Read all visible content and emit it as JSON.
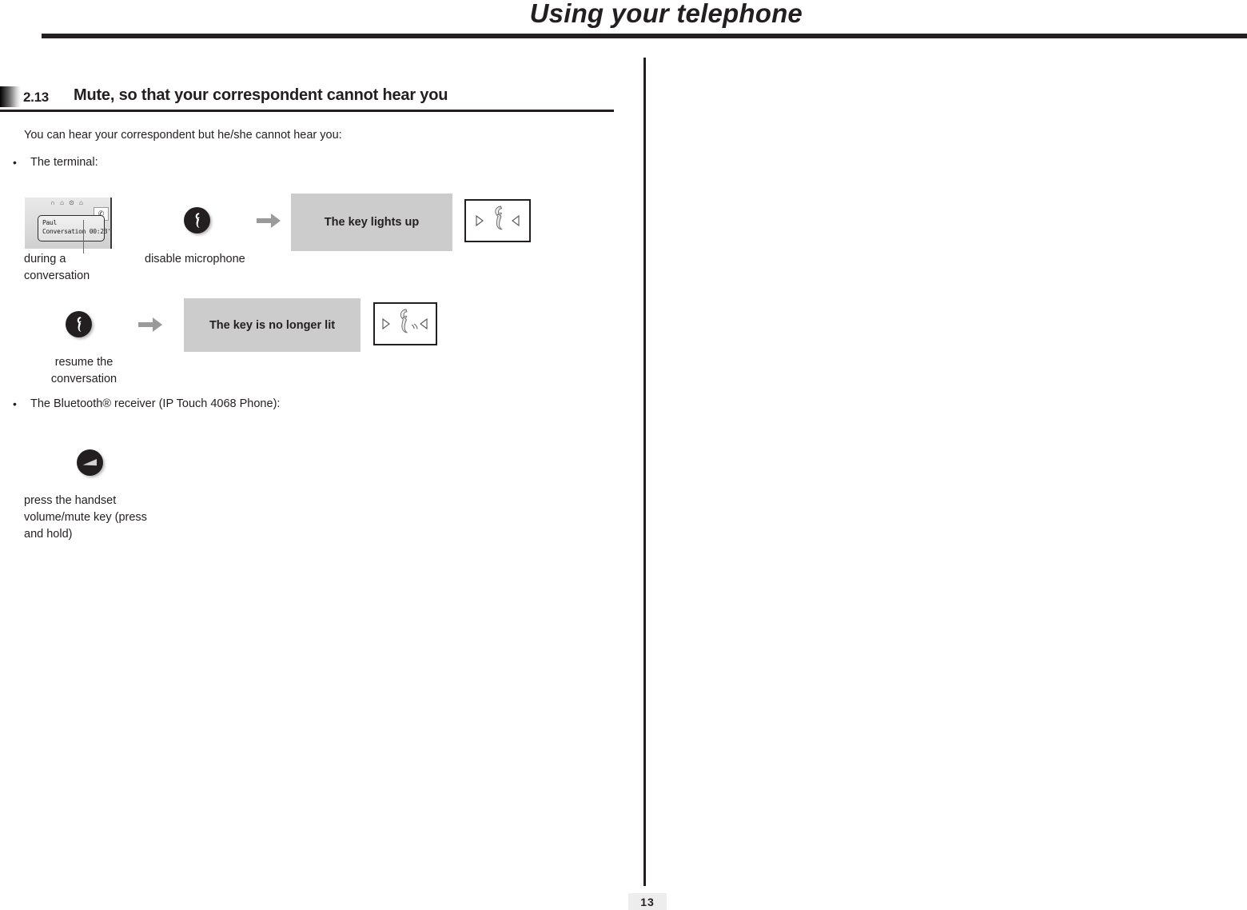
{
  "header": {
    "title": "Using your telephone"
  },
  "section": {
    "number": "2.13",
    "title": "Mute, so that your correspondent cannot hear you"
  },
  "intro": {
    "text": "You can hear your correspondent but he/she cannot hear you:"
  },
  "bullets": [
    {
      "marker": "•",
      "label": "The terminal:"
    },
    {
      "marker": "•",
      "label": "The Bluetooth® receiver (IP Touch 4068 Phone):"
    }
  ],
  "lcd": {
    "status_icons": "∩ ⌂ ⊙ ⌂",
    "softkey_glyph": "✆",
    "line1": "Paul",
    "line2": "Conversation 00:23'"
  },
  "steps": [
    {
      "icon": "mute-key-icon",
      "caption": "during a\nconversation",
      "caption_line1": "during a",
      "caption_line2": "conversation"
    },
    {
      "icon": "mute-key-icon",
      "caption": "disable microphone",
      "arrow": "→",
      "result_label": "The key lights up",
      "key_state": "lit"
    },
    {
      "icon": "mute-key-icon",
      "caption_line1": "resume the",
      "caption_line2": "conversation",
      "arrow": "→",
      "result_label": "The key is no longer lit",
      "key_state": "unlit"
    }
  ],
  "bluetooth_step": {
    "icon": "volume-mute-key-icon",
    "caption_line1": "press the handset",
    "caption_line2": "volume/mute key (press",
    "caption_line3": "and hold)"
  },
  "footer": {
    "page_number": "13"
  },
  "colors": {
    "ink": "#231f20",
    "result_box_bg": "#cccccc",
    "page_number_bg": "#ededed",
    "arrow": "#9a9a9a"
  }
}
